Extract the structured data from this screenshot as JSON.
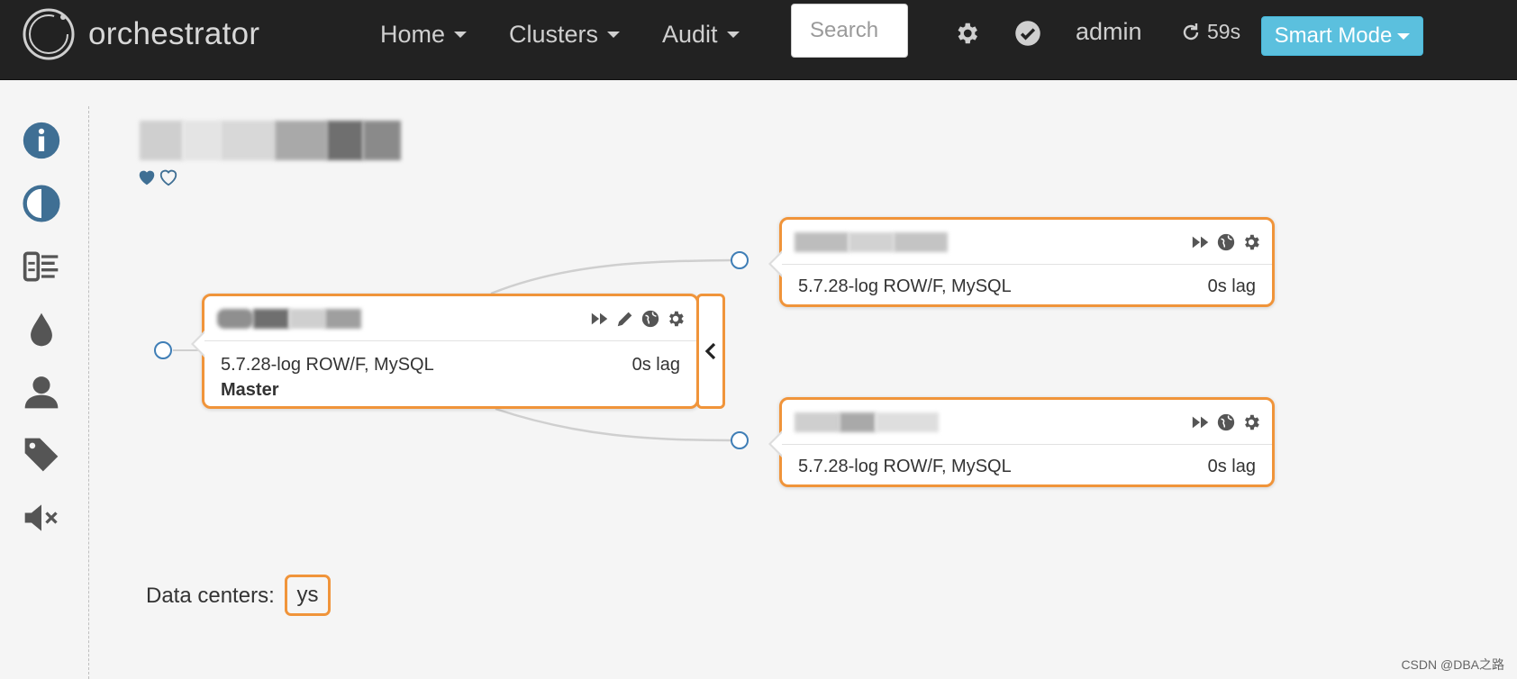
{
  "navbar": {
    "brand": "orchestrator",
    "menus": [
      {
        "label": "Home"
      },
      {
        "label": "Clusters"
      },
      {
        "label": "Audit"
      }
    ],
    "search_placeholder": "Search",
    "user": "admin",
    "refresh_countdown": "59s",
    "smart_mode_label": "Smart Mode"
  },
  "sidebar": {
    "icons": [
      "info-icon",
      "contrast-icon",
      "pools-icon",
      "drop-icon",
      "user-icon",
      "tag-icon",
      "mute-icon"
    ]
  },
  "cluster": {
    "favorite_icons": [
      "heart-filled-icon",
      "heart-outline-icon"
    ]
  },
  "nodes": {
    "master": {
      "info": "5.7.28-log ROW/F, MySQL",
      "lag": "0s lag",
      "role": "Master"
    },
    "replica1": {
      "info": "5.7.28-log ROW/F, MySQL",
      "lag": "0s lag"
    },
    "replica2": {
      "info": "5.7.28-log ROW/F, MySQL",
      "lag": "0s lag"
    }
  },
  "data_centers": {
    "label": "Data centers:",
    "items": [
      "ys"
    ]
  },
  "watermark": "CSDN @DBA之路",
  "colors": {
    "navbar_bg": "#222222",
    "node_border": "#f0943a",
    "smart_mode_bg": "#5bc0de",
    "icon_blue": "#3f6f94",
    "link_dot": "#3f7eb6"
  }
}
